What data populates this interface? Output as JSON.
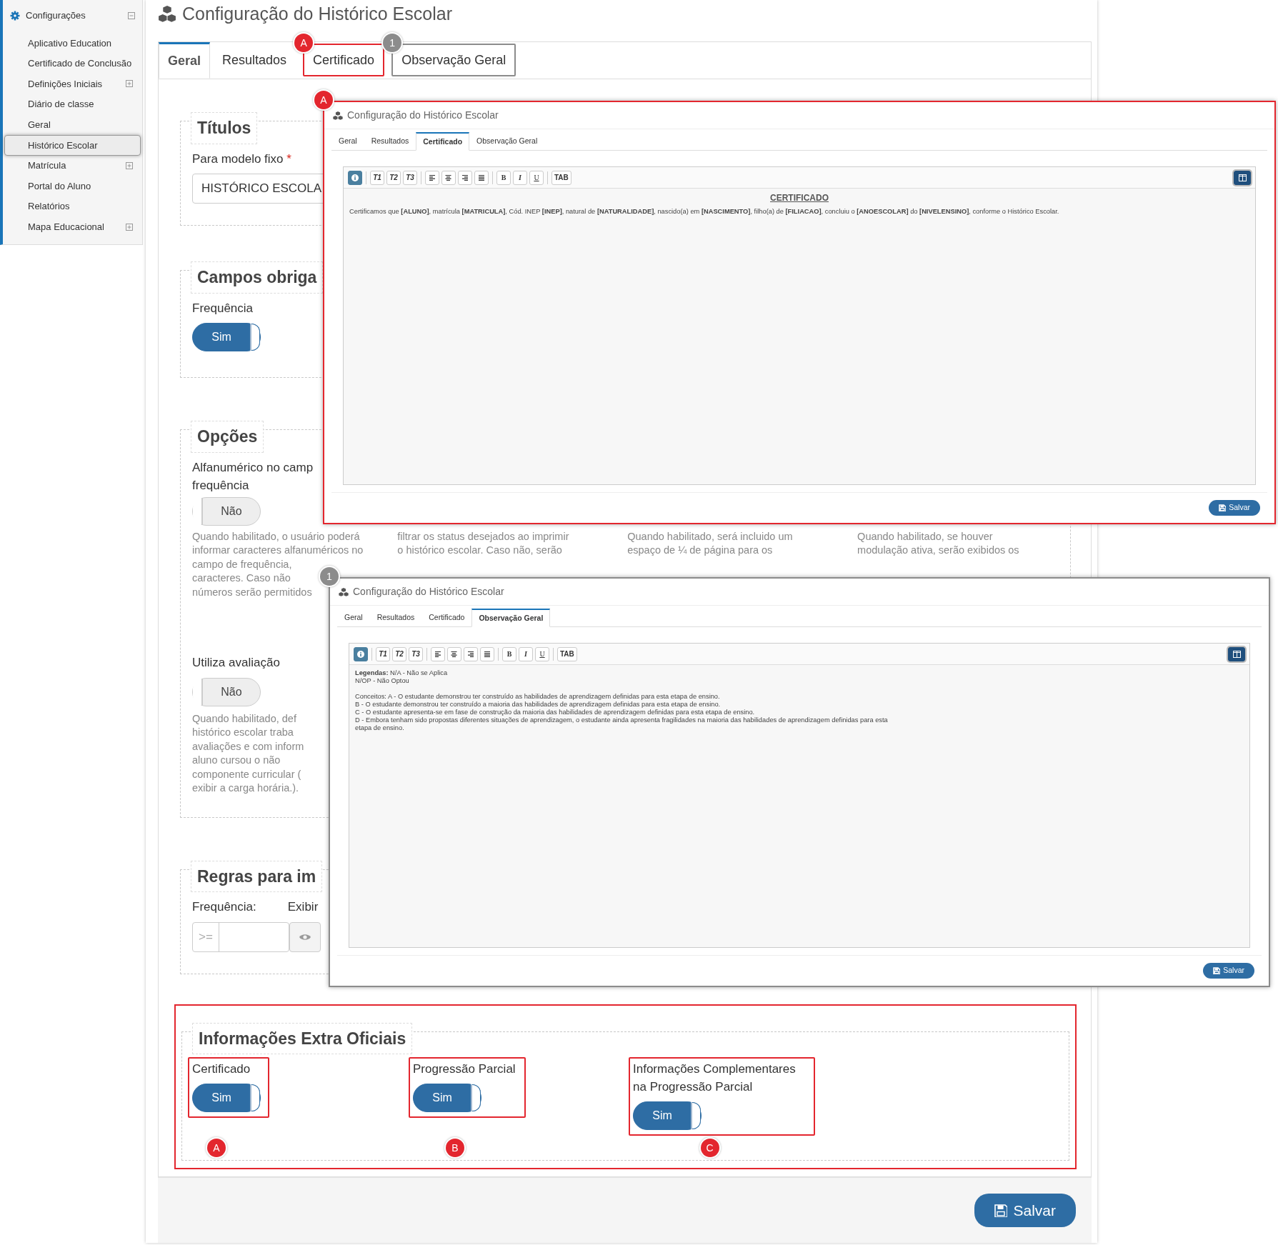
{
  "sidebar": {
    "header": {
      "label": "Configurações",
      "expanded": true
    },
    "items": [
      {
        "label": "Aplicativo Education",
        "selected": false,
        "expandable": false
      },
      {
        "label": "Certificado de Conclusão",
        "selected": false,
        "expandable": false
      },
      {
        "label": "Definições Iniciais",
        "selected": false,
        "expandable": true
      },
      {
        "label": "Diário de classe",
        "selected": false,
        "expandable": false
      },
      {
        "label": "Geral",
        "selected": false,
        "expandable": false
      },
      {
        "label": "Histórico Escolar",
        "selected": true,
        "expandable": false
      },
      {
        "label": "Matrícula",
        "selected": false,
        "expandable": true
      },
      {
        "label": "Portal do Aluno",
        "selected": false,
        "expandable": false
      },
      {
        "label": "Relatórios",
        "selected": false,
        "expandable": false
      },
      {
        "label": "Mapa Educacional",
        "selected": false,
        "expandable": true
      }
    ]
  },
  "page": {
    "title": "Configuração do Histórico Escolar"
  },
  "tabs": [
    {
      "label": "Geral",
      "selected": true
    },
    {
      "label": "Resultados",
      "selected": false
    },
    {
      "label": "Certificado",
      "selected": false,
      "callout": {
        "label": "A",
        "color": "#e3262e"
      }
    },
    {
      "label": "Observação Geral",
      "selected": false,
      "callout": {
        "label": "1",
        "color": "#8c8c8c"
      }
    }
  ],
  "titulos": {
    "legend": "Títulos",
    "label": "Para modelo fixo",
    "required": "*",
    "value": "HISTÓRICO ESCOLA"
  },
  "campos": {
    "legend": "Campos obriga",
    "label": "Frequência",
    "toggle": {
      "text": "Sim",
      "on": true
    }
  },
  "opcoes": {
    "legend": "Opções",
    "columns": [
      {
        "label_lines": [
          "Alfanumérico no camp",
          "frequência"
        ],
        "toggle": {
          "text": "Não",
          "on": false
        },
        "help_lines": [
          "Quando habilitado, o usuário poderá",
          "informar caracteres alfanuméricos no",
          "campo de frequência,",
          "caracteres. Caso não",
          "números serão permitidos"
        ]
      },
      {
        "help_lines": [
          "filtrar os status desejados ao imprimir",
          "o histórico escolar. Caso não, serão"
        ]
      },
      {
        "help_lines": [
          "Quando habilitado, será incluido um",
          "espaço de ¼ de página para os"
        ]
      },
      {
        "help_lines": [
          "Quando habilitado, se houver",
          "modulação ativa, serão exibidos os"
        ]
      }
    ],
    "second": {
      "label": "Utiliza avaliação",
      "toggle": {
        "text": "Não",
        "on": false
      },
      "help_lines": [
        "Quando habilitado, def",
        "histórico escolar traba",
        "avaliações e com inform",
        "aluno cursou o não",
        "componente curricular (",
        "exibir a carga horária.)."
      ]
    }
  },
  "regras": {
    "legend": "Regras para im",
    "labels": [
      "Frequência:",
      "Exibir"
    ],
    "prefix": ">="
  },
  "extra": {
    "legend": "Informações Extra Oficiais",
    "highlighted": true,
    "fields": [
      {
        "label": "Certificado",
        "toggle": {
          "text": "Sim",
          "on": true
        },
        "callout": {
          "label": "A",
          "color": "#e3262e"
        }
      },
      {
        "label": "Progressão Parcial",
        "toggle": {
          "text": "Sim",
          "on": true
        },
        "callout": {
          "label": "B",
          "color": "#e3262e"
        }
      },
      {
        "label": "Informações Complementares na Progressão Parcial",
        "toggle": {
          "text": "Sim",
          "on": true
        },
        "callout": {
          "label": "C",
          "color": "#e3262e"
        }
      }
    ]
  },
  "save_button": "Salvar",
  "popups": [
    {
      "title": "Configuração do Histórico Escolar",
      "callout": {
        "label": "A",
        "color": "#e3262e"
      },
      "tabs": [
        {
          "label": "Geral",
          "selected": false
        },
        {
          "label": "Resultados",
          "selected": false
        },
        {
          "label": "Certificado",
          "selected": true
        },
        {
          "label": "Observação Geral",
          "selected": false
        }
      ],
      "toolbar": [
        {
          "kind": "info"
        },
        {
          "kind": "heading",
          "label": "T1"
        },
        {
          "kind": "heading",
          "label": "T2"
        },
        {
          "kind": "heading",
          "label": "T3"
        },
        {
          "kind": "align-left"
        },
        {
          "kind": "align-center"
        },
        {
          "kind": "align-right"
        },
        {
          "kind": "justify"
        },
        {
          "kind": "bold",
          "label": "B"
        },
        {
          "kind": "italic",
          "label": "I"
        },
        {
          "kind": "underline",
          "label": "U"
        },
        {
          "kind": "tab",
          "label": "TAB"
        },
        {
          "kind": "layout"
        }
      ],
      "heading": "CERTIFICADO",
      "blocks": [
        [
          "Certificamos que **[ALUNO]**, matrícula **[MATRICULA]**, Cód. INEP **[INEP]**, natural de **[NATURALIDADE]**, nascido(a) em **[NASCIMENTO]**, filho(a) de **[FILIACAO]**, concluiu o **[ANOESCOLAR]** do **[NIVELENSINO]**, conforme o Histórico Escolar."
        ]
      ],
      "save": "Salvar"
    },
    {
      "title": "Configuração do Histórico Escolar",
      "callout": {
        "label": "1",
        "color": "#8c8c8c"
      },
      "tabs": [
        {
          "label": "Geral",
          "selected": false
        },
        {
          "label": "Resultados",
          "selected": false
        },
        {
          "label": "Certificado",
          "selected": false
        },
        {
          "label": "Observação Geral",
          "selected": true
        }
      ],
      "toolbar": [
        {
          "kind": "info"
        },
        {
          "kind": "heading",
          "label": "T1"
        },
        {
          "kind": "heading",
          "label": "T2"
        },
        {
          "kind": "heading",
          "label": "T3"
        },
        {
          "kind": "align-left"
        },
        {
          "kind": "align-center"
        },
        {
          "kind": "align-right"
        },
        {
          "kind": "justify"
        },
        {
          "kind": "bold",
          "label": "B"
        },
        {
          "kind": "italic",
          "label": "I"
        },
        {
          "kind": "underline",
          "label": "U"
        },
        {
          "kind": "tab",
          "label": "TAB"
        },
        {
          "kind": "layout"
        }
      ],
      "blocks": [
        [
          "**Legendas:** N/A - Não se Aplica",
          "N/OP - Não Optou"
        ],
        [
          "Conceitos: A - O estudante demonstrou ter construído as habilidades de aprendizagem definidas para esta etapa de ensino.",
          "B - O estudante demonstrou ter construído a maioria das habilidades de aprendizagem definidas para esta etapa de ensino.",
          "C - O estudante apresenta-se em fase de construção da maioria das habilidades de aprendizagem definidas para esta etapa de ensino.",
          "D - Embora tenham sido propostas diferentes situações de aprendizagem, o estudante ainda apresenta fragilidades na maioria das habilidades de aprendizagem definidas para esta",
          "etapa de ensino."
        ]
      ],
      "save": "Salvar"
    }
  ]
}
